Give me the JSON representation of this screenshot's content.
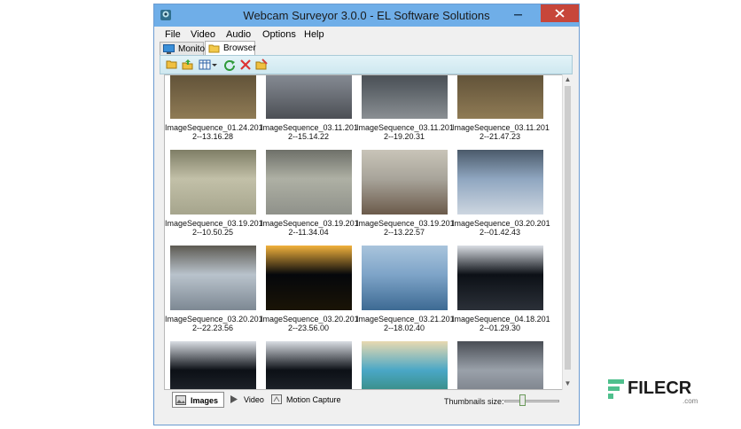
{
  "window": {
    "title": "Webcam Surveyor 3.0.0 - EL Software Solutions",
    "menu": [
      "File",
      "Video",
      "Audio",
      "Options",
      "Help"
    ],
    "tabs": [
      {
        "label": "Monitor",
        "active": false,
        "icon": "monitor-icon"
      },
      {
        "label": "Browser",
        "active": true,
        "icon": "folder-icon"
      }
    ],
    "toolbar": [
      "open-folder-icon",
      "export-icon",
      "grid-view-icon",
      "dropdown-arrow-icon",
      "refresh-icon",
      "delete-icon",
      "rename-folder-icon"
    ]
  },
  "gallery": {
    "items": [
      {
        "caption_line1": "ImageSequence_01.24.201",
        "caption_line2": "2--13.16.28",
        "scene": "landscape-dusk"
      },
      {
        "caption_line1": "ImageSequence_03.11.201",
        "caption_line2": "2--15.14.22",
        "scene": "city-grey"
      },
      {
        "caption_line1": "ImageSequence_03.11.201",
        "caption_line2": "2--19.20.31",
        "scene": "street"
      },
      {
        "caption_line1": "ImageSequence_03.11.201",
        "caption_line2": "2--21.47.23",
        "scene": "landscape-dusk"
      },
      {
        "caption_line1": "ImageSequence_03.19.201",
        "caption_line2": "2--10.50.25",
        "scene": "fog"
      },
      {
        "caption_line1": "ImageSequence_03.19.201",
        "caption_line2": "2--11.34.04",
        "scene": "fog2"
      },
      {
        "caption_line1": "ImageSequence_03.19.201",
        "caption_line2": "2--13.22.57",
        "scene": "town-square"
      },
      {
        "caption_line1": "ImageSequence_03.20.201",
        "caption_line2": "2--01.42.43",
        "scene": "snow-village"
      },
      {
        "caption_line1": "ImageSequence_03.20.201",
        "caption_line2": "2--22.23.56",
        "scene": "clouds"
      },
      {
        "caption_line1": "ImageSequence_03.20.201",
        "caption_line2": "2--23.56.00",
        "scene": "night-lights"
      },
      {
        "caption_line1": "ImageSequence_03.21.201",
        "caption_line2": "2--18.02.40",
        "scene": "sea-volcano"
      },
      {
        "caption_line1": "ImageSequence_04.18.201",
        "caption_line2": "2--01.29.30",
        "scene": "night-plaza"
      },
      {
        "caption_line1": "",
        "caption_line2": "",
        "scene": "night-plaza"
      },
      {
        "caption_line1": "",
        "caption_line2": "",
        "scene": "night-plaza"
      },
      {
        "caption_line1": "",
        "caption_line2": "",
        "scene": "beach-palm"
      },
      {
        "caption_line1": "",
        "caption_line2": "",
        "scene": "dusk-hills"
      }
    ]
  },
  "bottom": {
    "tabs": [
      {
        "label": "Images",
        "active": true,
        "icon": "image-icon"
      },
      {
        "label": "Video",
        "active": false,
        "icon": "play-icon"
      },
      {
        "label": "Motion Capture",
        "active": false,
        "icon": "motion-icon"
      }
    ],
    "thumbnails_size_label": "Thumbnails size:",
    "thumbnails_size_level": 0.3
  },
  "watermark": {
    "brand": "FILECR",
    "sub": ".com"
  },
  "colors": {
    "titlebar": "#6faee8",
    "close": "#c7463a",
    "toolbar": "#d9eef5",
    "brand": "#3aa57a"
  }
}
